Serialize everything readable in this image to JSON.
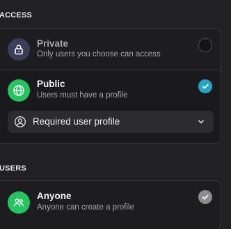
{
  "access": {
    "section_label": "ACCESS",
    "options": [
      {
        "title": "Private",
        "subtitle": "Only users you choose can access",
        "icon": "lock-icon",
        "selected": false
      },
      {
        "title": "Public",
        "subtitle": "Users must have a profile",
        "icon": "globe-icon",
        "selected": true
      }
    ],
    "profile_select": {
      "value": "Required user profile",
      "icon": "user-circle-icon"
    }
  },
  "users": {
    "section_label": "USERS",
    "options": [
      {
        "title": "Anyone",
        "subtitle": "Anyone can create a profile",
        "icon": "users-icon",
        "selected": true
      }
    ]
  },
  "colors": {
    "background": "#212123",
    "accent_teal": "#22a6c6",
    "accent_green": "#22c55e"
  }
}
